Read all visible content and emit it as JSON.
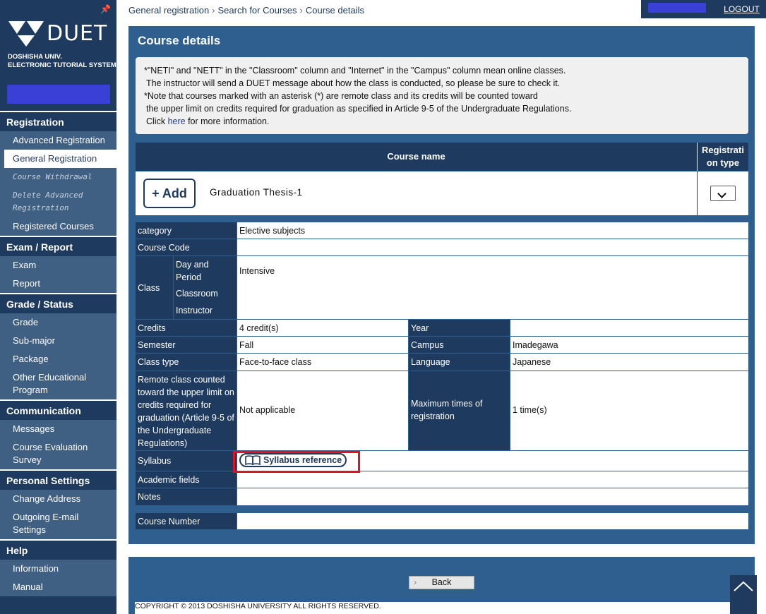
{
  "brand": {
    "logo_text": "DUET",
    "sub_line1": "DOSHISHA UNIV.",
    "sub_line2": "ELECTRONIC TUTORIAL SYSTEM"
  },
  "sidebar": {
    "sections": [
      {
        "title": "Registration",
        "items": [
          {
            "label": "Advanced Registration",
            "state": "normal"
          },
          {
            "label": "General Registration",
            "state": "active"
          },
          {
            "label": "Course Withdrawal",
            "state": "disabled"
          },
          {
            "label": "Delete Advanced Registration",
            "state": "disabled"
          },
          {
            "label": "Registered Courses",
            "state": "normal"
          }
        ]
      },
      {
        "title": "Exam / Report",
        "items": [
          {
            "label": "Exam",
            "state": "normal"
          },
          {
            "label": "Report",
            "state": "normal"
          }
        ]
      },
      {
        "title": "Grade / Status",
        "items": [
          {
            "label": "Grade",
            "state": "normal"
          },
          {
            "label": "Sub-major",
            "state": "normal"
          },
          {
            "label": "Package",
            "state": "normal"
          },
          {
            "label": "Other Educational Program",
            "state": "normal"
          }
        ]
      },
      {
        "title": "Communication",
        "items": [
          {
            "label": "Messages",
            "state": "normal"
          },
          {
            "label": "Course Evaluation Survey",
            "state": "normal"
          }
        ]
      },
      {
        "title": "Personal Settings",
        "items": [
          {
            "label": "Change Address",
            "state": "normal"
          },
          {
            "label": "Outgoing E-mail Settings",
            "state": "normal"
          }
        ]
      },
      {
        "title": "Help",
        "items": [
          {
            "label": "Information",
            "state": "normal"
          },
          {
            "label": "Manual",
            "state": "normal"
          }
        ]
      }
    ]
  },
  "header": {
    "breadcrumb": [
      "General registration",
      "Search for Courses",
      "Course details"
    ],
    "logout": "LOGOUT"
  },
  "main": {
    "title": "Course details",
    "notice": {
      "line1": "*\"NETI\" and \"NETT\" in the \"Classroom\" column and \"Internet\" in the \"Campus\" column mean online classes.",
      "line2": "The instructor will send a DUET message about how the class is conducted, so please be sure to check it.",
      "line3": "*Note that courses marked with an asterisk (*) are remote class and its credits will be counted toward",
      "line4": "the upper limit on credits required for graduation as specified in Article 9-5 of the Undergraduate Regulations.",
      "click_prefix": "Click ",
      "link": "here",
      "click_suffix": " for more information."
    },
    "course_table": {
      "col_course_name": "Course name",
      "col_registration_type": "Registration type",
      "add_label": "+ Add",
      "course_name": "Graduation Thesis-1"
    },
    "details": {
      "category_label": "category",
      "category_value": "Elective subjects",
      "course_code_label": "Course Code",
      "course_code_value": "",
      "class_label": "Class",
      "day_period_label": "Day and Period",
      "day_period_value": "Intensive",
      "classroom_label": "Classroom",
      "instructor_label": "Instructor",
      "credits_label": "Credits",
      "credits_value": "4 credit(s)",
      "year_label": "Year",
      "year_value": "",
      "semester_label": "Semester",
      "semester_value": "Fall",
      "campus_label": "Campus",
      "campus_value": "Imadegawa",
      "class_type_label": "Class type",
      "class_type_value": "Face-to-face class",
      "language_label": "Language",
      "language_value": "Japanese",
      "remote_label": "Remote class counted toward the upper limit on credits required for graduation (Article 9-5 of the Undergraduate Regulations)",
      "remote_value": "Not applicable",
      "max_times_label": "Maximum times of registration",
      "max_times_value": "1 time(s)",
      "syllabus_label": "Syllabus",
      "syllabus_button": "Syllabus reference",
      "academic_fields_label": "Academic fields",
      "notes_label": "Notes",
      "course_number_label": "Course Number"
    },
    "back_button": "Back",
    "copyright": "COPYRIGHT © 2013 DOSHISHA UNIVERSITY ALL RIGHTS RESERVED."
  },
  "colors": {
    "navy": "#1e3a5f",
    "panel": "#2f5f8f",
    "sidebar_item": "#3f5f83",
    "highlight": "#e0141e",
    "user_block": "#3a3fd6"
  }
}
